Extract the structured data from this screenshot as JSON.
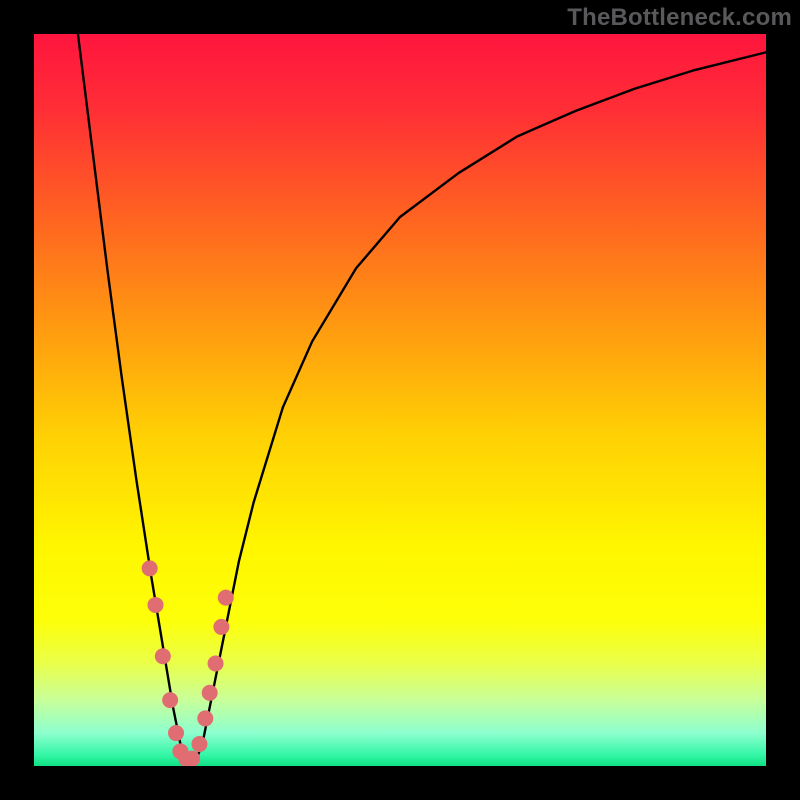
{
  "watermark": "TheBottleneck.com",
  "chart_data": {
    "type": "line",
    "title": "",
    "xlabel": "",
    "ylabel": "",
    "xlim": [
      0,
      100
    ],
    "ylim": [
      0,
      100
    ],
    "background_gradient": {
      "stops": [
        {
          "offset": 0.0,
          "color": "#ff153e"
        },
        {
          "offset": 0.1,
          "color": "#ff2d36"
        },
        {
          "offset": 0.25,
          "color": "#ff6321"
        },
        {
          "offset": 0.4,
          "color": "#ff9a10"
        },
        {
          "offset": 0.55,
          "color": "#ffd104"
        },
        {
          "offset": 0.7,
          "color": "#fff600"
        },
        {
          "offset": 0.8,
          "color": "#fdff08"
        },
        {
          "offset": 0.86,
          "color": "#eaff4a"
        },
        {
          "offset": 0.91,
          "color": "#c8ff9a"
        },
        {
          "offset": 0.955,
          "color": "#8dffcf"
        },
        {
          "offset": 0.985,
          "color": "#34f6a6"
        },
        {
          "offset": 1.0,
          "color": "#0ee184"
        }
      ]
    },
    "series": [
      {
        "name": "bottleneck-curve",
        "color": "#000000",
        "x": [
          6,
          8,
          10,
          12,
          14,
          16,
          17,
          18,
          19,
          20,
          21,
          22,
          23,
          24,
          26,
          28,
          30,
          34,
          38,
          44,
          50,
          58,
          66,
          74,
          82,
          90,
          100
        ],
        "y": [
          100,
          84,
          68,
          53,
          39,
          26,
          20,
          14,
          8,
          3,
          0.5,
          0.5,
          3,
          8,
          18,
          28,
          36,
          49,
          58,
          68,
          75,
          81,
          86,
          89.5,
          92.5,
          95,
          97.5
        ]
      }
    ],
    "markers": {
      "name": "sample-points",
      "color": "#e06d71",
      "radius_px": 8,
      "x": [
        15.8,
        16.6,
        17.6,
        18.6,
        19.4,
        20.0,
        20.8,
        21.6,
        22.6,
        23.4,
        24.0,
        24.8,
        25.6,
        26.2
      ],
      "y": [
        27,
        22,
        15,
        9,
        4.5,
        2,
        1,
        1,
        3,
        6.5,
        10,
        14,
        19,
        23
      ]
    }
  }
}
